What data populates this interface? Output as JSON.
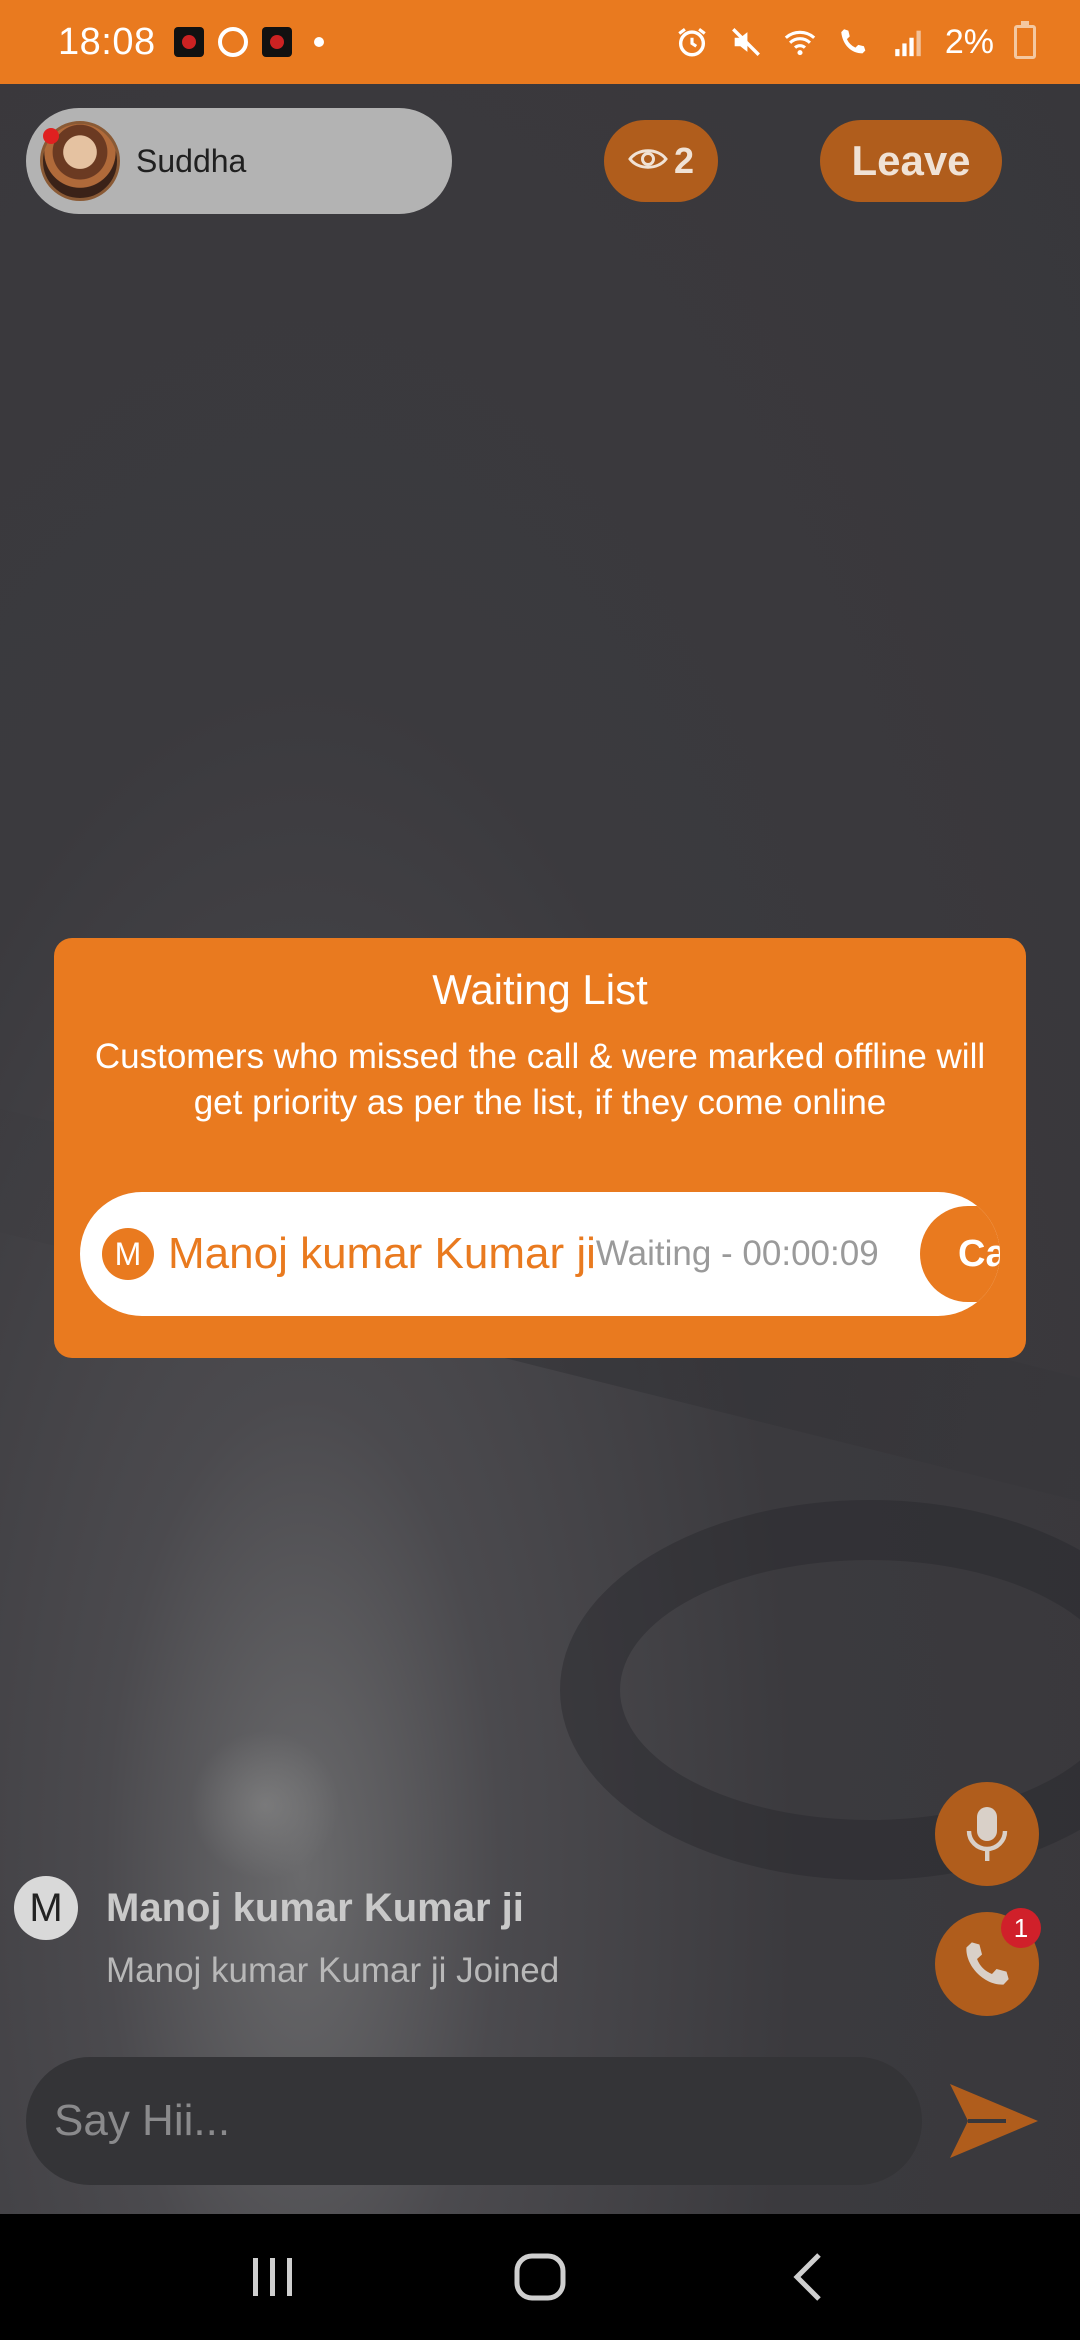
{
  "status_bar": {
    "time": "18:08",
    "battery": "2%"
  },
  "header": {
    "host_name": "Suddha",
    "viewer_count": "2",
    "leave_label": "Leave"
  },
  "waiting_list": {
    "title": "Waiting List",
    "description": "Customers who missed the call & were marked offline will get priority as per the list, if they come online",
    "items": [
      {
        "initial": "M",
        "name": "Manoj kumar Kumar ji",
        "status": "Waiting - 00:00:09",
        "action_label": "Ca"
      }
    ]
  },
  "call_badge": "1",
  "chat": {
    "messages": [
      {
        "initial": "M",
        "name": "Manoj kumar Kumar ji",
        "text": "Manoj kumar Kumar ji Joined"
      }
    ],
    "input_placeholder": "Say Hii..."
  },
  "colors": {
    "accent": "#e97a1f",
    "accent_dark": "#b05d1c",
    "badge_red": "#d0202a"
  }
}
